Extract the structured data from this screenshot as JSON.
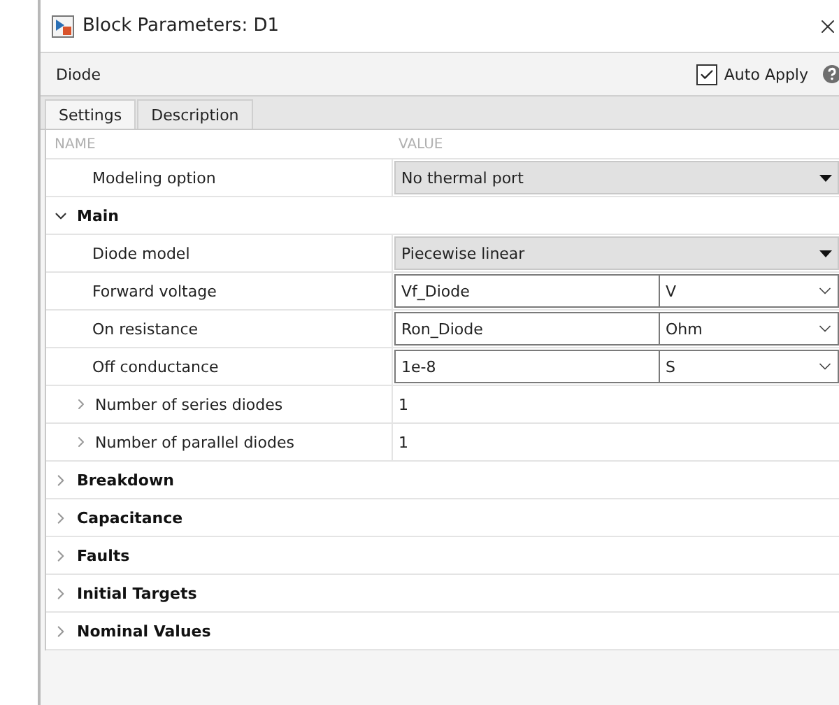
{
  "window": {
    "title": "Block Parameters: D1"
  },
  "header": {
    "block_name": "Diode",
    "auto_apply": {
      "label": "Auto Apply",
      "checked": true
    }
  },
  "tabs": [
    {
      "label": "Settings",
      "selected": true
    },
    {
      "label": "Description",
      "selected": false
    }
  ],
  "table": {
    "columns": [
      "NAME",
      "VALUE"
    ],
    "rows": [
      {
        "kind": "dropdown",
        "name": "Modeling option",
        "value": "No thermal port"
      },
      {
        "kind": "group",
        "name": "Main",
        "expanded": true,
        "children": [
          {
            "kind": "dropdown",
            "name": "Diode model",
            "value": "Piecewise linear"
          },
          {
            "kind": "unit_field",
            "name": "Forward voltage",
            "value": "Vf_Diode",
            "unit": "V"
          },
          {
            "kind": "unit_field",
            "name": "On resistance",
            "value": "Ron_Diode",
            "unit": "Ohm"
          },
          {
            "kind": "unit_field",
            "name": "Off conductance",
            "value": "1e-8",
            "unit": "S"
          },
          {
            "kind": "expandable",
            "name": "Number of series diodes",
            "value": "1",
            "expanded": false
          },
          {
            "kind": "expandable",
            "name": "Number of parallel diodes",
            "value": "1",
            "expanded": false
          }
        ]
      },
      {
        "kind": "group",
        "name": "Breakdown",
        "expanded": false
      },
      {
        "kind": "group",
        "name": "Capacitance",
        "expanded": false
      },
      {
        "kind": "group",
        "name": "Faults",
        "expanded": false
      },
      {
        "kind": "group",
        "name": "Initial Targets",
        "expanded": false
      },
      {
        "kind": "group",
        "name": "Nominal Values",
        "expanded": false
      }
    ]
  }
}
